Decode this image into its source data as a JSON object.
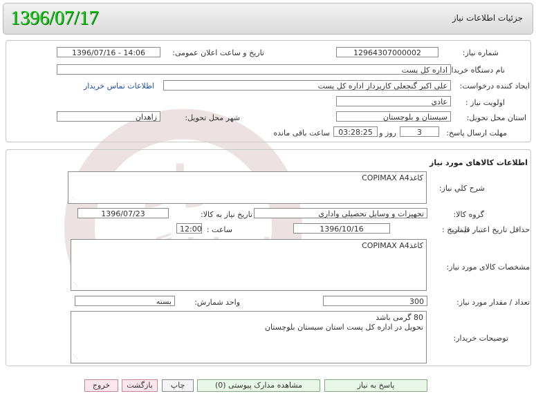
{
  "header": {
    "title": "جزئیات اطلاعات نیاز",
    "date": "1396/07/17"
  },
  "info": {
    "need_number_label": "شماره نیاز:",
    "need_number": "12964307000002",
    "announce_label": "تاریخ و ساعت اعلان عمومی:",
    "announce_value": "1396/07/16 - 14:06",
    "buyer_org_label": "نام دستگاه خریدار:",
    "buyer_org": "اداره کل پست",
    "requester_label": "ایجاد کننده درخواست:",
    "requester": "علی اکبر گنجعلی کارپرداز اداره کل پست",
    "contact_link": "اطلاعات تماس خریدار",
    "priority_label": "اولویت نیاز :",
    "priority": "عادي",
    "province_label": "استان محل تحویل:",
    "province": "سيستان و بلوچستان",
    "city_label": "شهر محل تحویل:",
    "city": "زاهدان",
    "deadline_label": "مهلت ارسال پاسخ:",
    "days": "3",
    "days_suffix": "روز و",
    "time_left": "03:28:25",
    "time_left_suffix": "ساعت باقی مانده"
  },
  "goods": {
    "section_title": "اطلاعات کالاهای مورد نیاز",
    "desc_label": "شرح کلي نياز:",
    "desc": "کاغذCOPIMAX A4",
    "group_label": "گروه کالا:",
    "group": "تجهيزات و وسايل تحصيلي واداري",
    "need_date_label": "تاریخ نیاز به کالا:",
    "need_date": "1396/07/23",
    "validity_label": "حداقل تاریخ اعتبار قیمت:",
    "to_date_label": "تا تاریخ :",
    "to_date": "1396/10/16",
    "time_label": "ساعت :",
    "time": "12:00",
    "spec_label": "مشخصات کالای مورد نیاز:",
    "spec": "کاغذCOPIMAX A4",
    "qty_label": "تعداد / مقدار مورد نیاز:",
    "qty": "300",
    "unit_label": "واحد شمارش:",
    "unit": "بسته",
    "notes_label": "توضیحات خریدار:",
    "notes_line1": "80 گرمی باشد",
    "notes_line2": "تحویل در اداره کل پست استان سیستان بلوچستان"
  },
  "buttons": {
    "reply": "پاسخ به نیاز",
    "attachments": "مشاهده مدارک پیوستی (0)",
    "print": "چاپ",
    "back": "بازگشت",
    "exit": "خروج"
  },
  "watermark": {
    "text1": "هزاره",
    "text2": "ارتباط گستر"
  }
}
